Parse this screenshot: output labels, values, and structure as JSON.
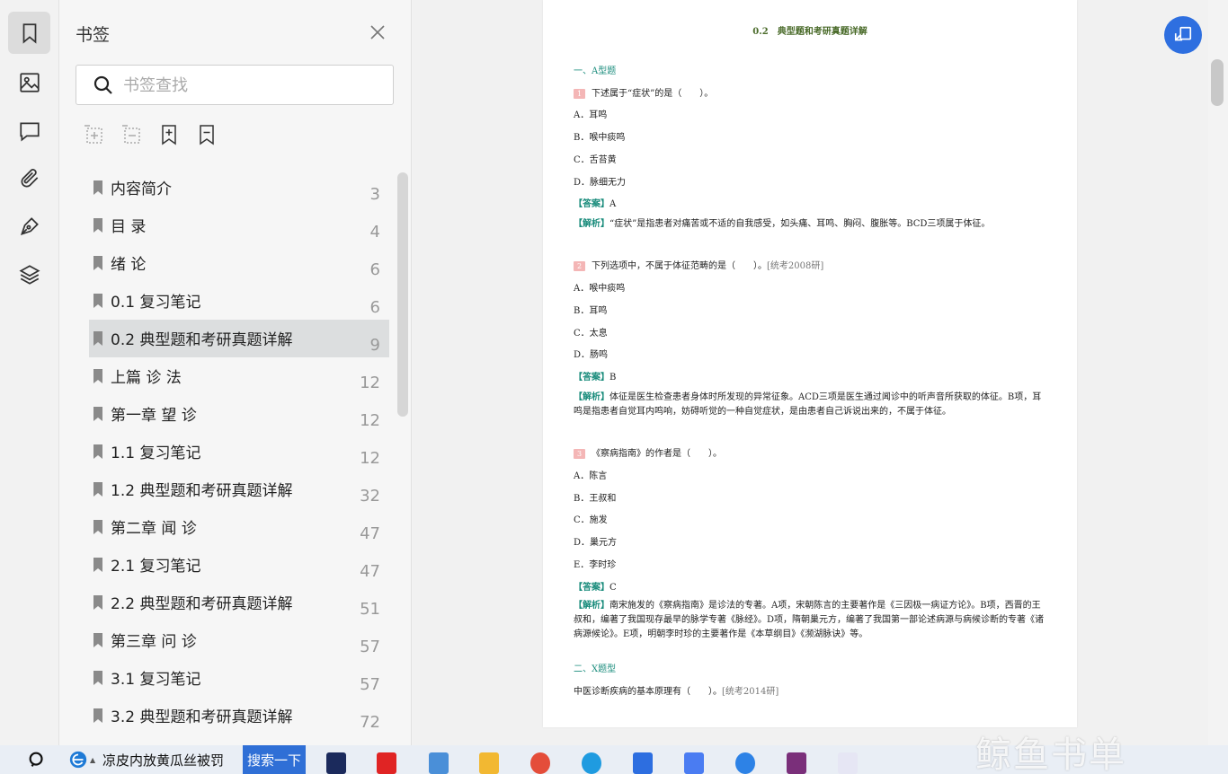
{
  "panel": {
    "title": "书签",
    "search_placeholder": "书签查找"
  },
  "bookmarks": [
    {
      "label": "内容简介",
      "page": "3"
    },
    {
      "label": "目 录",
      "page": "4"
    },
    {
      "label": "绪 论",
      "page": "6"
    },
    {
      "label": "0.1 复习笔记",
      "page": "6"
    },
    {
      "label": "0.2 典型题和考研真题详解",
      "page": "9",
      "selected": true
    },
    {
      "label": "上篇 诊 法",
      "page": "12"
    },
    {
      "label": "第一章 望 诊",
      "page": "12"
    },
    {
      "label": "1.1 复习笔记",
      "page": "12"
    },
    {
      "label": "1.2 典型题和考研真题详解",
      "page": "32"
    },
    {
      "label": "第二章 闻 诊",
      "page": "47"
    },
    {
      "label": "2.1 复习笔记",
      "page": "47"
    },
    {
      "label": "2.2 典型题和考研真题详解",
      "page": "51"
    },
    {
      "label": "第三章 问 诊",
      "page": "57"
    },
    {
      "label": "3.1 复习笔记",
      "page": "57"
    },
    {
      "label": "3.2 典型题和考研真题详解",
      "page": "72"
    }
  ],
  "document": {
    "title": "0.2　典型题和考研真题详解",
    "section_a": "一、A型题",
    "q1": {
      "num": "1",
      "text": "下述属于“症状”的是（　　）。",
      "options": [
        "A．耳鸣",
        "B．喉中痰鸣",
        "C．舌苔黄",
        "D．脉细无力"
      ],
      "answer_label": "【答案】",
      "answer": "A",
      "analysis_label": "【解析】",
      "analysis": "“症状”是指患者对痛苦或不适的自我感受，如头痛、耳鸣、胸闷、腹胀等。BCD三项属于体征。"
    },
    "q2": {
      "num": "2",
      "text": "下列选项中，不属于体征范畴的是（　　）。",
      "source": "[统考2008研]",
      "options": [
        "A．喉中痰鸣",
        "B．耳鸣",
        "C．太息",
        "D．肠鸣"
      ],
      "answer_label": "【答案】",
      "answer": "B",
      "analysis_label": "【解析】",
      "analysis": "体征是医生检查患者身体时所发现的异常征象。ACD三项是医生通过闻诊中的听声音所获取的体征。B项，耳鸣是指患者自觉耳内鸣响，妨碍听觉的一种自觉症状，是由患者自己诉说出来的，不属于体征。"
    },
    "q3": {
      "num": "3",
      "text": "《察病指南》的作者是（　　）。",
      "options": [
        "A．陈言",
        "B．王叔和",
        "C．施发",
        "D．巢元方",
        "E．李时珍"
      ],
      "answer_label": "【答案】",
      "answer": "C",
      "analysis_label": "【解析】",
      "analysis": "南宋施发的《察病指南》是诊法的专著。A项，宋朝陈言的主要著作是《三因极一病证方论》。B项，西晋的王叔和，编著了我国现存最早的脉学专著《脉经》。D项，隋朝巢元方，编著了我国第一部论述病源与病候诊断的专著《诸病源候论》。E项，明朝李时珍的主要著作是《本草纲目》《濒湖脉诀》等。"
    },
    "section_x": "二、X题型",
    "q_x": {
      "text": "中医诊断疾病的基本原理有（　　）。",
      "source": "[统考2014研]"
    }
  },
  "taskbar": {
    "search_text": "凉皮内放黄瓜丝被罚",
    "search_button": "搜索一下"
  },
  "watermark": "鲸鱼书单",
  "colors": {
    "accent_teal": "#1a8c7c",
    "float_button": "#2e6fe0",
    "taskbar_button": "#2f6fd6"
  }
}
